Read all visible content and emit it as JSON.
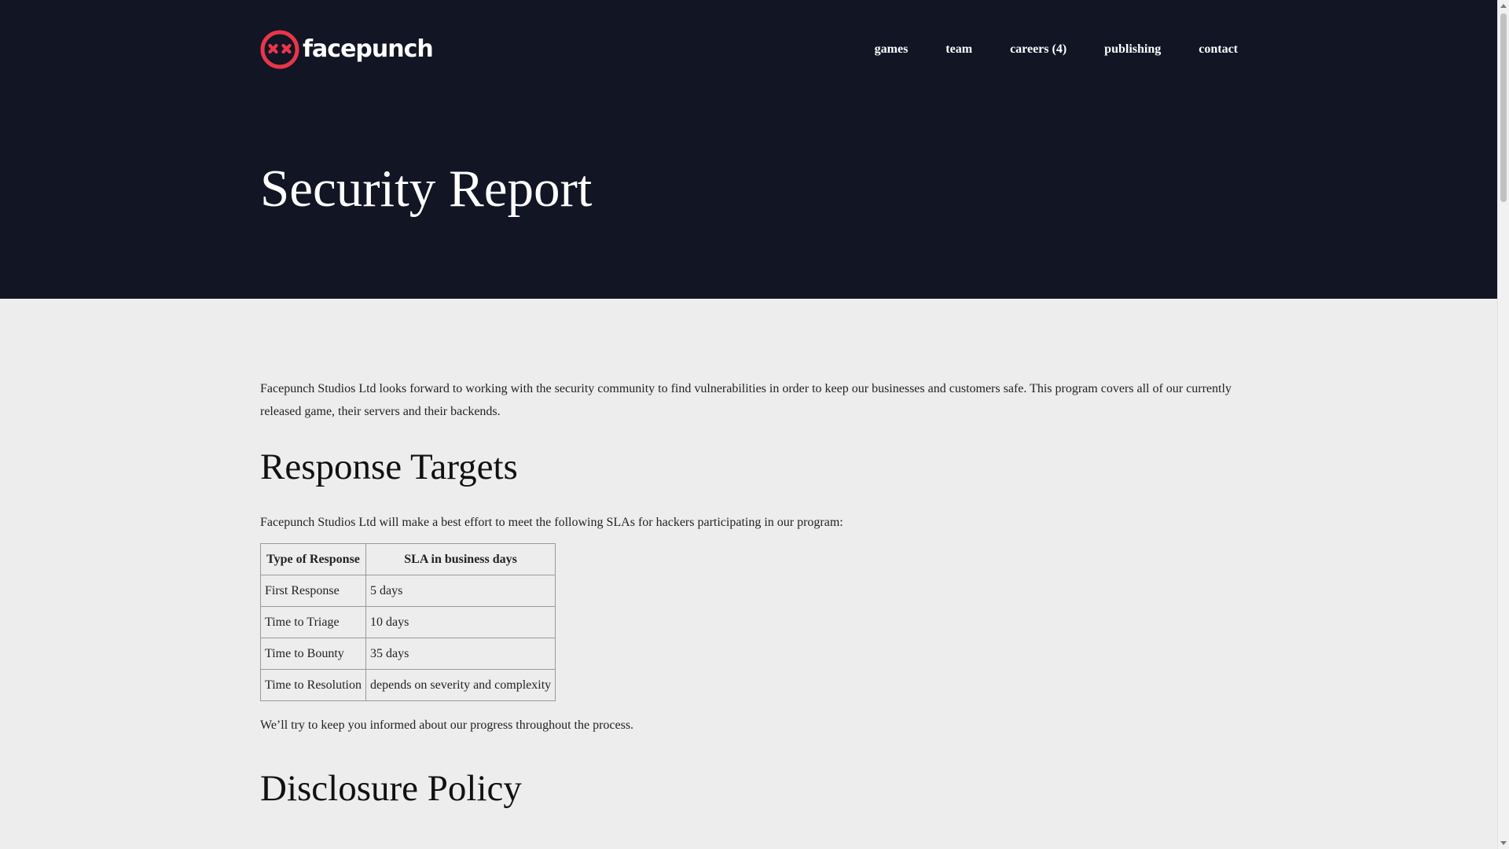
{
  "header": {
    "logo_text": "facepunch",
    "nav": [
      {
        "label": "games"
      },
      {
        "label": "team"
      },
      {
        "label": "careers (4)"
      },
      {
        "label": "publishing"
      },
      {
        "label": "contact"
      }
    ],
    "page_title": "Security Report"
  },
  "main": {
    "intro": "Facepunch Studios Ltd looks forward to working with the security community to find vulnerabilities in order to keep our businesses and customers safe. This program covers all of our currently released game, their servers and their backends.",
    "response_heading": "Response Targets",
    "sla_intro": "Facepunch Studios Ltd will make a best effort to meet the following SLAs for hackers participating in our program:",
    "table": {
      "headers": [
        "Type of Response",
        "SLA in business days"
      ],
      "rows": [
        [
          "First Response",
          "5 days"
        ],
        [
          "Time to Triage",
          "10 days"
        ],
        [
          "Time to Bounty",
          "35 days"
        ],
        [
          "Time to Resolution",
          "depends on severity and complexity"
        ]
      ]
    },
    "after_table": "We’ll try to keep you informed about our progress throughout the process.",
    "disclosure_heading": "Disclosure Policy"
  },
  "colors": {
    "hero_bg": "#111524",
    "page_bg": "#ededed",
    "brand_red": "#e8364a"
  },
  "icons": {
    "logo_mark": "facepunch-logo-icon"
  }
}
